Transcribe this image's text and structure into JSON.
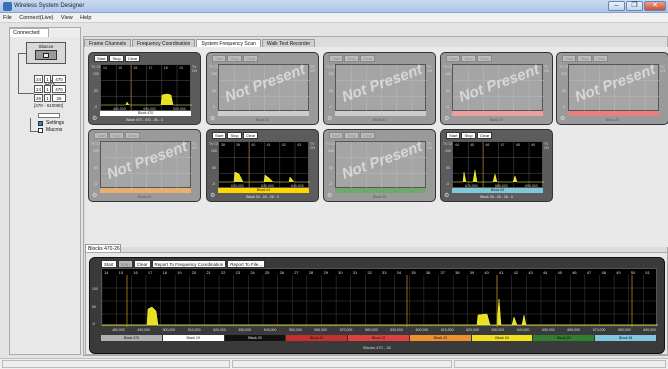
{
  "app": {
    "title": "Wireless System Designer"
  },
  "window_controls": {
    "minimize": "–",
    "restore": "❐",
    "close": "✕"
  },
  "menu": [
    "File",
    "Connect(Live)",
    "View",
    "Help"
  ],
  "left_panel": {
    "tab": "Connected",
    "device_label": "Sbacce",
    "receiver_label": "DR",
    "channels": [
      {
        "a": "24",
        "b": "1",
        "c": "470"
      },
      {
        "a": "24",
        "b": "1",
        "c": "470"
      },
      {
        "a": "26",
        "b": "1",
        "c": "26"
      }
    ],
    "range": "[470 - 610000]",
    "tree": [
      {
        "label": "Settings",
        "icon": "settings-icon"
      },
      {
        "label": "Macros",
        "icon": "macros-icon"
      }
    ]
  },
  "tabs": [
    "Frame Channels",
    "Frequency Coordination",
    "System Frequency Scan",
    "Walk Test Recorder"
  ],
  "active_tab": 2,
  "panel_buttons": {
    "start": "Start",
    "stop": "Stop",
    "clear": "Clear"
  },
  "panels": [
    {
      "present": true,
      "chtags": [
        "14",
        "15",
        "16",
        "17",
        "18",
        "19"
      ],
      "freqs": [
        "480,000",
        "490,000",
        "500,000"
      ],
      "block": "Block 470",
      "block_color": "#ffffff",
      "footer": "Block 470 - 470 - 26 - 3"
    },
    {
      "present": false,
      "block": "",
      "block_color": "#cccccc",
      "footer": "Block 20"
    },
    {
      "present": false,
      "block": "",
      "block_color": "#cccccc",
      "footer": "Block 21"
    },
    {
      "present": false,
      "block": "",
      "block_color": "#e8a0a0",
      "footer": "Block 22"
    },
    {
      "present": false,
      "block": "",
      "block_color": "#e88080",
      "footer": "Block 23"
    },
    {
      "present": false,
      "block": "",
      "block_color": "#e8b070",
      "footer": "Block 24"
    },
    {
      "present": true,
      "chtags": [
        "38",
        "39",
        "40",
        "41",
        "42",
        "43"
      ],
      "freqs": [
        "620,000",
        "630,000",
        "640,000"
      ],
      "block": "Block 24",
      "block_color": "#ffd700",
      "footer": "Block 24 - 24 - 26 - 3"
    },
    {
      "present": false,
      "block": "",
      "block_color": "#70a870",
      "footer": "Block 25"
    },
    {
      "present": true,
      "chtags": [
        "44",
        "45",
        "46",
        "47",
        "48",
        "49"
      ],
      "freqs": [
        "670,000",
        "680,000",
        "690,000"
      ],
      "block": "Block 26",
      "block_color": "#7ec8d8",
      "footer": "Block 26 - 26 - 26 - 3"
    }
  ],
  "not_present_text": "Not Present",
  "y_ticks": [
    "100",
    "50",
    "-0"
  ],
  "axis_corner": "TV CH",
  "lower_tab": "Blocks 470-26",
  "big_buttons": {
    "start": "Start",
    "stop": "Stop",
    "clear": "Clear",
    "report_coord": "Report To Frequency Coordination",
    "report_file": "Report To File..."
  },
  "big_chtags": [
    "14",
    "15",
    "16",
    "17",
    "18",
    "19",
    "20",
    "21",
    "22",
    "23",
    "24",
    "25",
    "26",
    "27",
    "28",
    "29",
    "30",
    "31",
    "32",
    "33",
    "34",
    "35",
    "36",
    "37",
    "38",
    "39",
    "40",
    "41",
    "42",
    "43",
    "44",
    "45",
    "46",
    "47",
    "48",
    "49",
    "50",
    "51"
  ],
  "big_freqs": [
    "480,000",
    "490,000",
    "500,000",
    "510,000",
    "520,000",
    "530,000",
    "540,000",
    "550,000",
    "560,000",
    "570,000",
    "580,000",
    "590,000",
    "600,000",
    "610,000",
    "620,000",
    "630,000",
    "640,000",
    "650,000",
    "660,000",
    "670,000",
    "680,000",
    "690,000"
  ],
  "big_blocks": [
    {
      "label": "Block 470",
      "color": "#b0b0b0"
    },
    {
      "label": "Block 19",
      "color": "#ffffff"
    },
    {
      "label": "Block 20",
      "color": "#111111"
    },
    {
      "label": "Block 21",
      "color": "#c83030"
    },
    {
      "label": "Block 22",
      "color": "#e04040"
    },
    {
      "label": "Block 23",
      "color": "#f09030"
    },
    {
      "label": "Block 24",
      "color": "#f0e020"
    },
    {
      "label": "Block 25",
      "color": "#308030"
    },
    {
      "label": "Block 26",
      "color": "#80c8e0"
    }
  ],
  "big_footer": "Blocks 470 - 26"
}
